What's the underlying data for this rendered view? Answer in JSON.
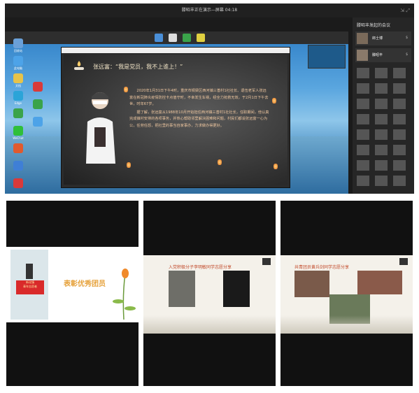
{
  "window": {
    "title": "滕昭丰正在演示—屏幕 04:18",
    "controls": "⇲ ⤢"
  },
  "desktop_icons": [
    {
      "label": "回收站",
      "color": "#6aa0d8"
    },
    {
      "label": "此电脑",
      "color": "#4da3e8"
    },
    {
      "label": "文档",
      "color": "#e6c34a"
    },
    {
      "label": "Edge",
      "color": "#2ba4d8"
    },
    {
      "label": "",
      "color": "#3aa34a"
    },
    {
      "label": "WeChat",
      "color": "#2fbf3a"
    },
    {
      "label": "",
      "color": "#e05a2e"
    },
    {
      "label": "",
      "color": "#3f7fd6"
    },
    {
      "label": "",
      "color": "#d93a3a"
    }
  ],
  "slide": {
    "title": "张远富：“我是党员，我不上谁上！”",
    "paragraph1": "2020年1月31日下午4时，重庆市铜梁区西河镇三善村1社社长、退伍老军人张远富在新冠肺炎疫情防控卡点值守时，不幸发生车祸，经全力抢救无效，于2月1日下午去世，时年67岁。",
    "paragraph2": "据了解，张远富从1988年10月开始担任西河镇三善村1社社长，任职期间，他认真完成镇村安排的各项事务，并热心帮助邻里解决困难和问题，村民们都说张远富一心为公，任劳任怨，把社里的事当自家事办，力求做办得更好。"
  },
  "meeting": {
    "title": "滕昭丰发起的会议",
    "participants": [
      {
        "name": "郎士博",
        "status": "$"
      },
      {
        "name": "滕昭丰",
        "status": "$"
      }
    ]
  },
  "panels": [
    {
      "title": "表彰优秀团员",
      "caption": "新化镇\n青年志愿者",
      "bg": "#ffffff"
    },
    {
      "title": "入党积极分子李明敏同学志愿分享",
      "bg": "#f4f1ea"
    },
    {
      "title": "共青团员黄兵剑同学志愿分享",
      "bg": "#f4f1ea"
    }
  ],
  "colors": {
    "accent_red": "#c24b2c",
    "panel_dark": "#111111"
  }
}
